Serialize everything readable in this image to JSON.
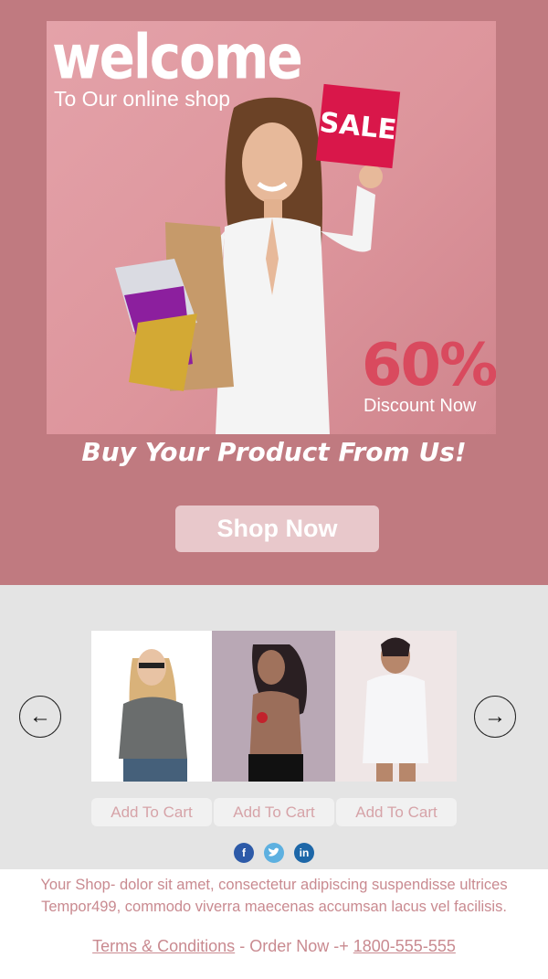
{
  "hero": {
    "welcome_title": "welcome",
    "welcome_subtitle": "To Our online shop",
    "sale_sign": "SALE",
    "discount_percent": "60%",
    "discount_label": "Discount Now",
    "tagline": "Buy Your Product From Us!",
    "shop_button": "Shop Now"
  },
  "products": {
    "prev_icon": "arrow-left-icon",
    "next_icon": "arrow-right-icon",
    "add_to_cart": [
      "Add To Cart",
      "Add To Cart",
      "Add To Cart"
    ],
    "social": [
      "facebook-icon",
      "twitter-icon",
      "linkedin-icon"
    ]
  },
  "footer": {
    "line1": "Your Shop- dolor sit amet, consectetur adipiscing suspendisse ultrices",
    "line2": "Tempor499,  commodo viverra maecenas accumsan lacus vel facilisis.",
    "terms_link": "Terms & Conditions",
    "order_text": " - Order Now -+",
    "phone_link": "1800-555-555"
  },
  "colors": {
    "hero_bg": "#c07a80",
    "banner_bg": "#e09aa1",
    "discount_red": "#d94a5e",
    "button_bg": "#e8c8cb",
    "products_bg": "#e4e4e4",
    "footer_text": "#c98a90"
  }
}
